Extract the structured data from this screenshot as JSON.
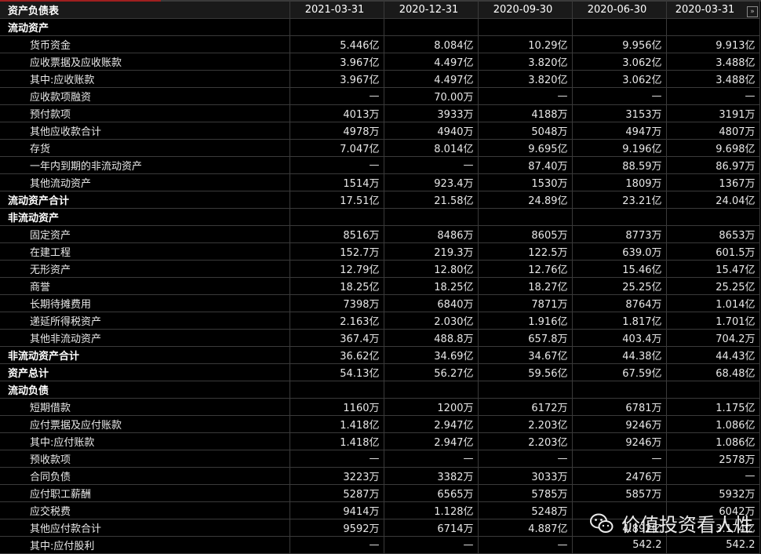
{
  "header": {
    "title": "资产负债表",
    "dates": [
      "2021-03-31",
      "2020-12-31",
      "2020-09-30",
      "2020-06-30",
      "2020-03-31"
    ],
    "next_icon": "double-chevron-right-icon",
    "next_label": "»"
  },
  "rows": [
    {
      "type": "cat",
      "label": "流动资产",
      "values": [
        "",
        "",
        "",
        "",
        ""
      ]
    },
    {
      "type": "item",
      "label": "货币资金",
      "values": [
        "5.446亿",
        "8.084亿",
        "10.29亿",
        "9.956亿",
        "9.913亿"
      ]
    },
    {
      "type": "item",
      "label": "应收票据及应收账款",
      "values": [
        "3.967亿",
        "4.497亿",
        "3.820亿",
        "3.062亿",
        "3.488亿"
      ]
    },
    {
      "type": "item",
      "label": "其中:应收账款",
      "values": [
        "3.967亿",
        "4.497亿",
        "3.820亿",
        "3.062亿",
        "3.488亿"
      ]
    },
    {
      "type": "item",
      "label": "应收款项融资",
      "values": [
        "—",
        "70.00万",
        "—",
        "—",
        "—"
      ]
    },
    {
      "type": "item",
      "label": "预付款项",
      "values": [
        "4013万",
        "3933万",
        "4188万",
        "3153万",
        "3191万"
      ]
    },
    {
      "type": "item",
      "label": "其他应收款合计",
      "values": [
        "4978万",
        "4940万",
        "5048万",
        "4947万",
        "4807万"
      ]
    },
    {
      "type": "item",
      "label": "存货",
      "values": [
        "7.047亿",
        "8.014亿",
        "9.695亿",
        "9.196亿",
        "9.698亿"
      ]
    },
    {
      "type": "item",
      "label": "一年内到期的非流动资产",
      "values": [
        "—",
        "—",
        "87.40万",
        "88.59万",
        "86.97万"
      ]
    },
    {
      "type": "item",
      "label": "其他流动资产",
      "values": [
        "1514万",
        "923.4万",
        "1530万",
        "1809万",
        "1367万"
      ]
    },
    {
      "type": "cat",
      "label": "流动资产合计",
      "values": [
        "17.51亿",
        "21.58亿",
        "24.89亿",
        "23.21亿",
        "24.04亿"
      ]
    },
    {
      "type": "cat",
      "label": "非流动资产",
      "values": [
        "",
        "",
        "",
        "",
        ""
      ]
    },
    {
      "type": "item",
      "label": "固定资产",
      "values": [
        "8516万",
        "8486万",
        "8605万",
        "8773万",
        "8653万"
      ]
    },
    {
      "type": "item",
      "label": "在建工程",
      "values": [
        "152.7万",
        "219.3万",
        "122.5万",
        "639.0万",
        "601.5万"
      ]
    },
    {
      "type": "item",
      "label": "无形资产",
      "values": [
        "12.79亿",
        "12.80亿",
        "12.76亿",
        "15.46亿",
        "15.47亿"
      ]
    },
    {
      "type": "item",
      "label": "商誉",
      "values": [
        "18.25亿",
        "18.25亿",
        "18.27亿",
        "25.25亿",
        "25.25亿"
      ]
    },
    {
      "type": "item",
      "label": "长期待摊费用",
      "values": [
        "7398万",
        "6840万",
        "7871万",
        "8764万",
        "1.014亿"
      ]
    },
    {
      "type": "item",
      "label": "递延所得税资产",
      "values": [
        "2.163亿",
        "2.030亿",
        "1.916亿",
        "1.817亿",
        "1.701亿"
      ]
    },
    {
      "type": "item",
      "label": "其他非流动资产",
      "values": [
        "367.4万",
        "488.8万",
        "657.8万",
        "403.4万",
        "704.2万"
      ]
    },
    {
      "type": "cat",
      "label": "非流动资产合计",
      "values": [
        "36.62亿",
        "34.69亿",
        "34.67亿",
        "44.38亿",
        "44.43亿"
      ]
    },
    {
      "type": "cat",
      "label": "资产总计",
      "values": [
        "54.13亿",
        "56.27亿",
        "59.56亿",
        "67.59亿",
        "68.48亿"
      ]
    },
    {
      "type": "cat",
      "label": "流动负债",
      "values": [
        "",
        "",
        "",
        "",
        ""
      ]
    },
    {
      "type": "item",
      "label": "短期借款",
      "values": [
        "1160万",
        "1200万",
        "6172万",
        "6781万",
        "1.175亿"
      ]
    },
    {
      "type": "item",
      "label": "应付票据及应付账款",
      "values": [
        "1.418亿",
        "2.947亿",
        "2.203亿",
        "9246万",
        "1.086亿"
      ]
    },
    {
      "type": "item",
      "label": "其中:应付账款",
      "values": [
        "1.418亿",
        "2.947亿",
        "2.203亿",
        "9246万",
        "1.086亿"
      ]
    },
    {
      "type": "item",
      "label": "预收款项",
      "values": [
        "—",
        "—",
        "—",
        "—",
        "2578万"
      ]
    },
    {
      "type": "item",
      "label": "合同负债",
      "values": [
        "3223万",
        "3382万",
        "3033万",
        "2476万",
        "—"
      ]
    },
    {
      "type": "item",
      "label": "应付职工薪酬",
      "values": [
        "5287万",
        "6565万",
        "5785万",
        "5857万",
        "5932万"
      ]
    },
    {
      "type": "item",
      "label": "应交税费",
      "values": [
        "9414万",
        "1.128亿",
        "5248万",
        "",
        "6042万"
      ]
    },
    {
      "type": "item",
      "label": "其他应付款合计",
      "values": [
        "9592万",
        "6714万",
        "4.887亿",
        "4.892亿",
        "3.174亿"
      ]
    },
    {
      "type": "item",
      "label": "其中:应付股利",
      "values": [
        "—",
        "—",
        "—",
        "542.2",
        "542.2"
      ]
    }
  ],
  "watermark": {
    "text": "价值投资看人性",
    "icon": "wechat-icon"
  }
}
